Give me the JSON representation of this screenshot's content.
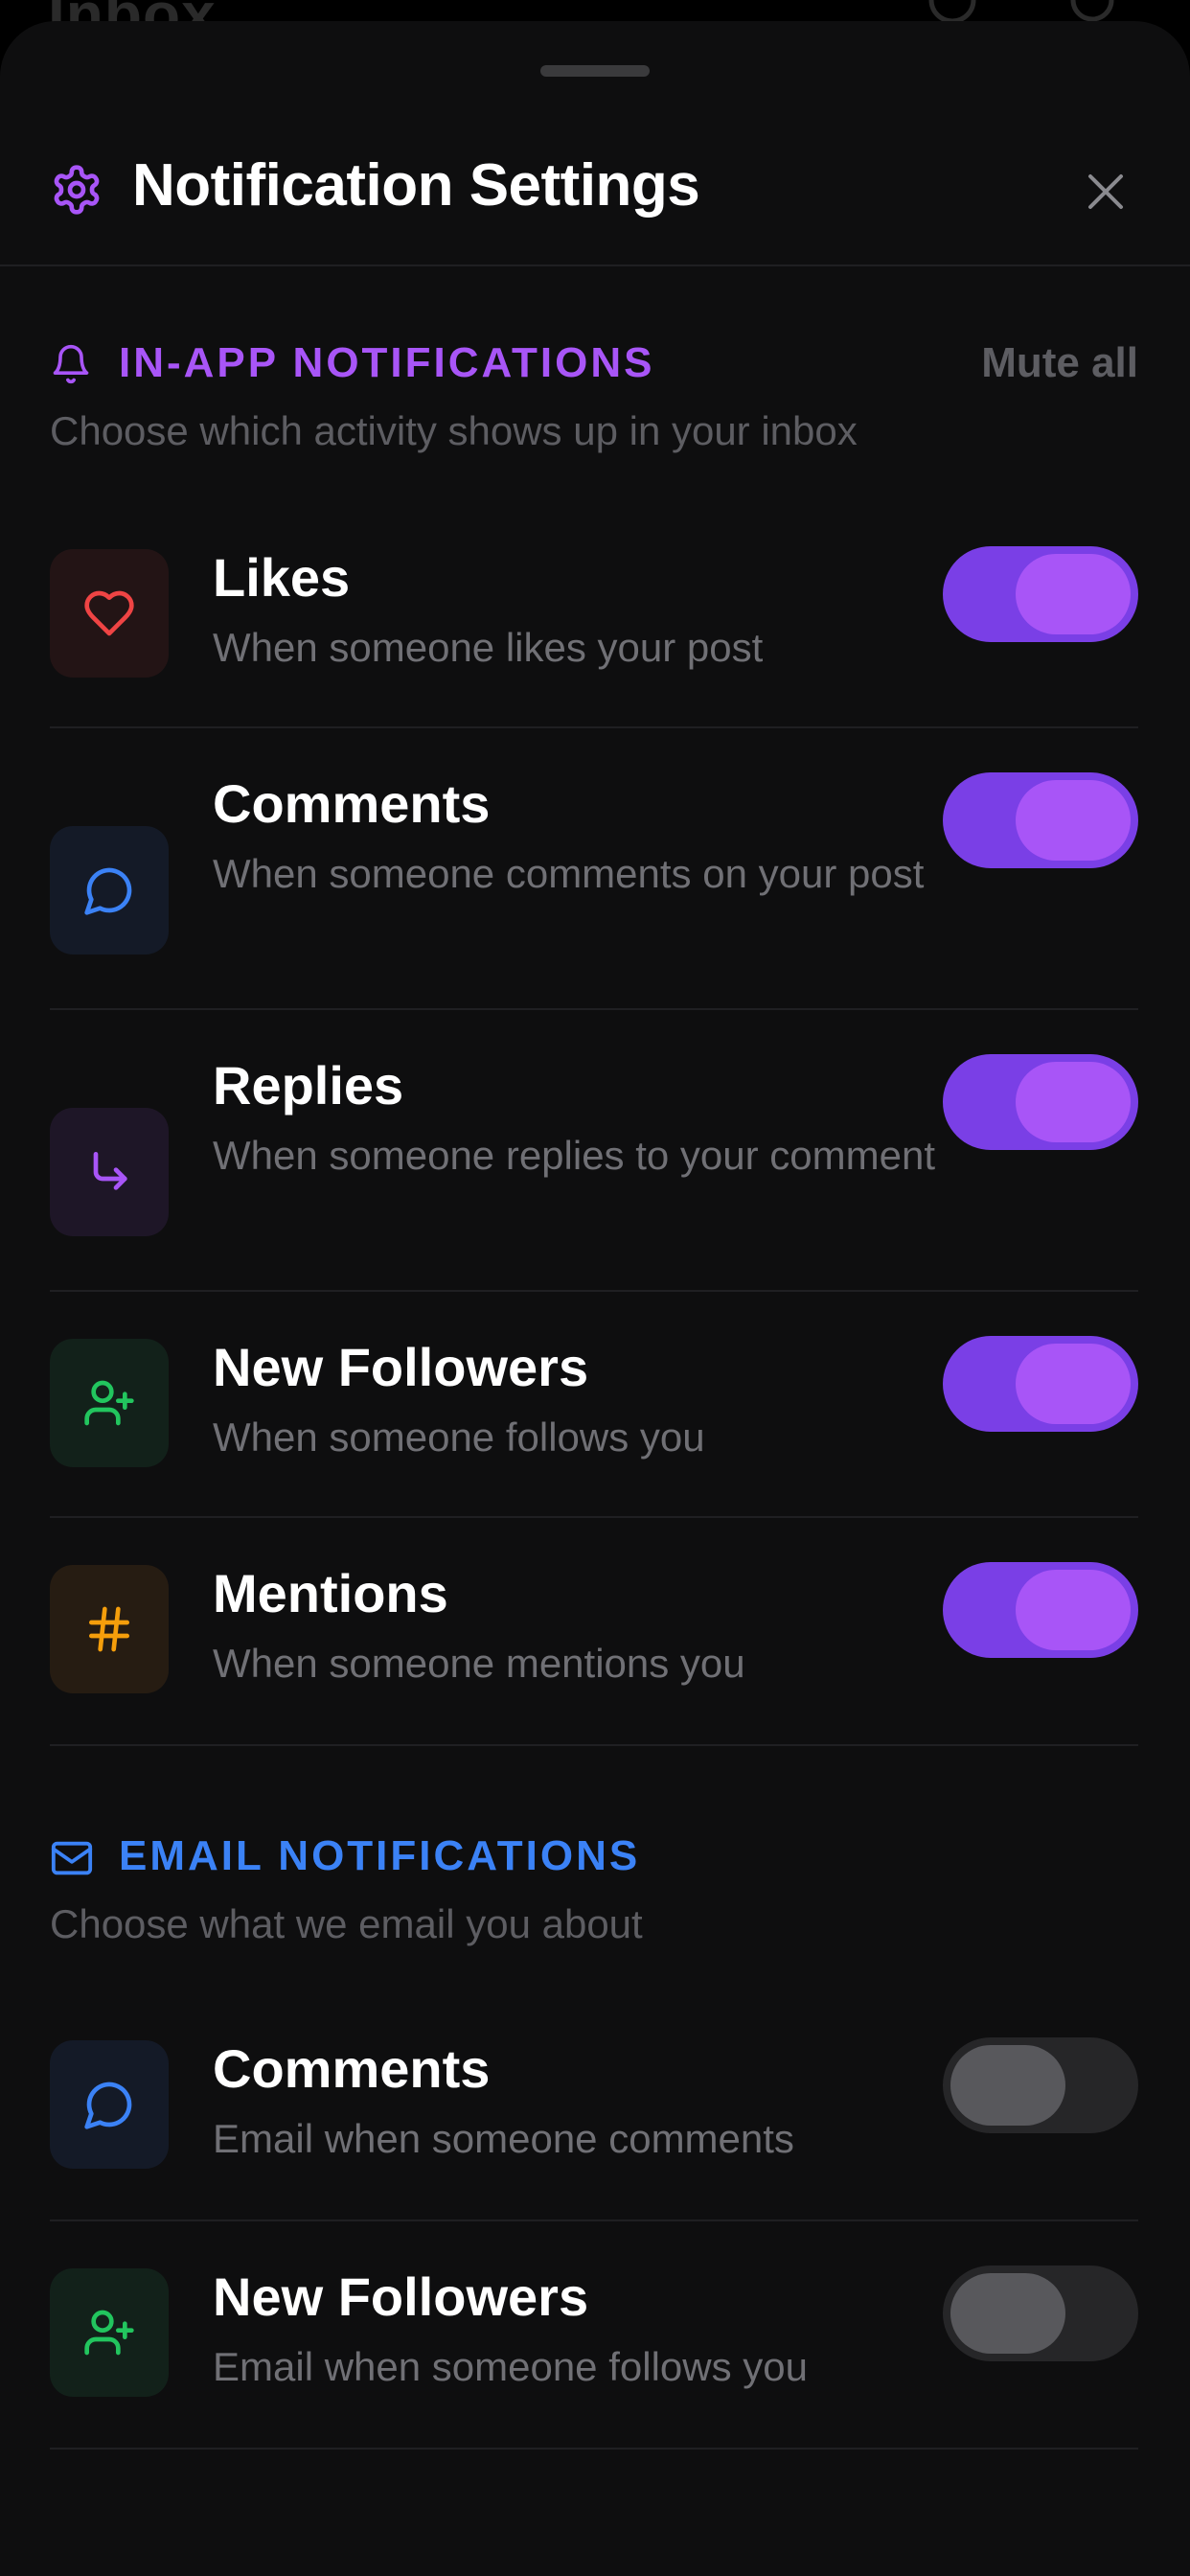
{
  "background": {
    "title": "Inbox"
  },
  "sheet": {
    "title": "Notification Settings"
  },
  "in_app": {
    "title": "IN-APP NOTIFICATIONS",
    "mute_label": "Mute all",
    "subtitle": "Choose which activity shows up in your inbox",
    "color": "#a855f7",
    "items": [
      {
        "title": "Likes",
        "desc": "When someone likes your post",
        "icon": "heart-icon",
        "on": true
      },
      {
        "title": "Comments",
        "desc": "When someone comments on your post",
        "icon": "comment-icon",
        "on": true
      },
      {
        "title": "Replies",
        "desc": "When someone replies to your comment",
        "icon": "reply-icon",
        "on": true
      },
      {
        "title": "New Followers",
        "desc": "When someone follows you",
        "icon": "user-plus-icon",
        "on": true
      },
      {
        "title": "Mentions",
        "desc": "When someone mentions you",
        "icon": "hashtag-icon",
        "on": true
      }
    ]
  },
  "email": {
    "title": "EMAIL NOTIFICATIONS",
    "subtitle": "Choose what we email you about",
    "color": "#3b82f6",
    "items": [
      {
        "title": "Comments",
        "desc": "Email when someone comments",
        "icon": "comment-icon",
        "on": false
      },
      {
        "title": "New Followers",
        "desc": "Email when someone follows you",
        "icon": "user-plus-icon",
        "on": false
      }
    ]
  }
}
